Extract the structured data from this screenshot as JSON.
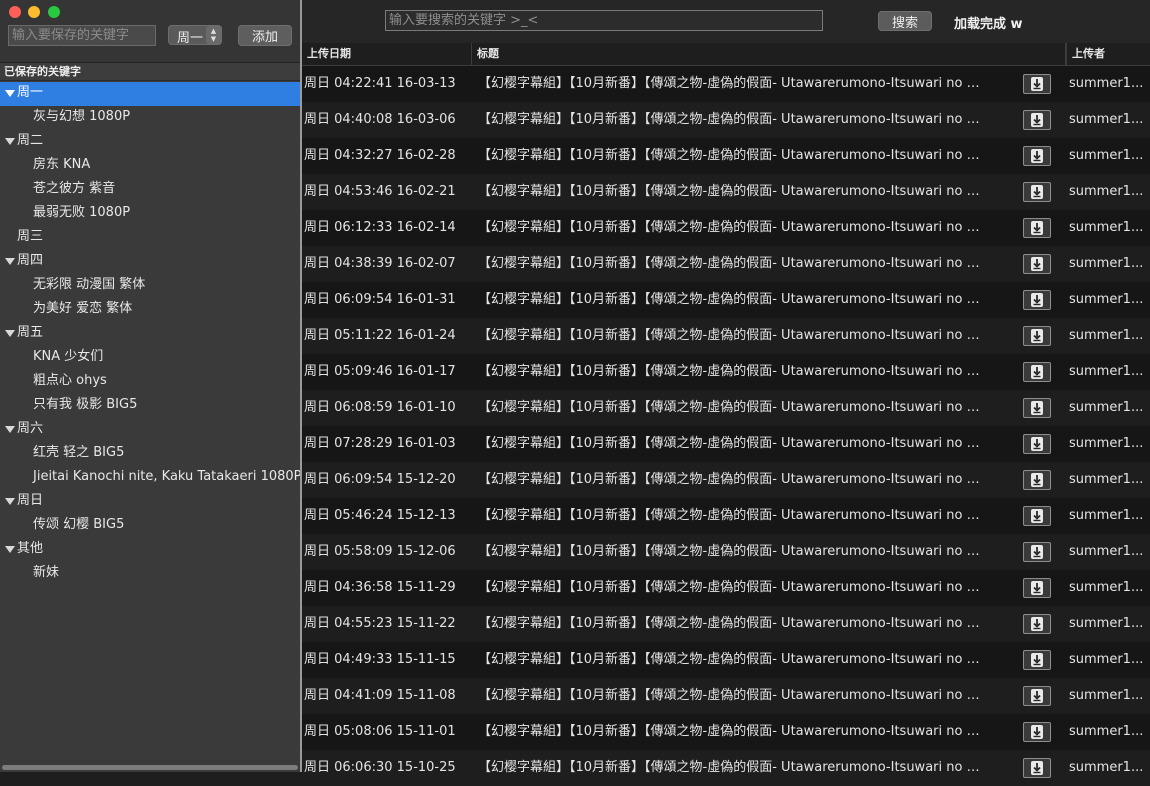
{
  "window": {
    "traffic_lights": {
      "close": "#fe5f57",
      "minimize": "#febc2e",
      "maximize": "#28c840"
    }
  },
  "left_panel": {
    "keyword_placeholder": "输入要保存的关键字",
    "day_select_value": "周一",
    "add_label": "添加",
    "saved_header": "已保存的关键字",
    "tree": [
      {
        "type": "group",
        "label": "周一",
        "expanded": true,
        "selected": true
      },
      {
        "type": "child",
        "label": "灰与幻想 1080P"
      },
      {
        "type": "group",
        "label": "周二",
        "expanded": true
      },
      {
        "type": "child",
        "label": "房东 KNA"
      },
      {
        "type": "child",
        "label": "苍之彼方 紫音"
      },
      {
        "type": "child",
        "label": "最弱无败 1080P"
      },
      {
        "type": "group",
        "label": "周三",
        "expanded": false
      },
      {
        "type": "group",
        "label": "周四",
        "expanded": true
      },
      {
        "type": "child",
        "label": "无彩限 动漫国 繁体"
      },
      {
        "type": "child",
        "label": "为美好 爱恋 繁体"
      },
      {
        "type": "group",
        "label": "周五",
        "expanded": true
      },
      {
        "type": "child",
        "label": "KNA 少女们"
      },
      {
        "type": "child",
        "label": "粗点心 ohys"
      },
      {
        "type": "child",
        "label": "只有我 极影 BIG5"
      },
      {
        "type": "group",
        "label": "周六",
        "expanded": true
      },
      {
        "type": "child",
        "label": "红壳 轻之 BIG5"
      },
      {
        "type": "child",
        "label": "Jieitai Kanochi nite, Kaku Tatakaeri 1080P"
      },
      {
        "type": "group",
        "label": "周日",
        "expanded": true
      },
      {
        "type": "child",
        "label": "传颂 幻樱 BIG5"
      },
      {
        "type": "group",
        "label": "其他",
        "expanded": true
      },
      {
        "type": "child",
        "label": "新妹"
      }
    ],
    "selection_color": "#2f7fe2"
  },
  "right_panel": {
    "search_placeholder": "输入要搜索的关键字 >_<",
    "search_label": "搜索",
    "status_text": "加载完成 w",
    "columns": {
      "date": "上传日期",
      "title": "标题",
      "uploader": "上传者"
    },
    "download_icon": "download-arrow-icon",
    "rows": [
      {
        "date": "周日 04:22:41 16-03-13",
        "title": "【幻樱字幕組】【10月新番】【傳頌之物-虛偽的假面- Utawarerumono-Itsuwari no K...",
        "uploader": "summer1..."
      },
      {
        "date": "周日 04:40:08 16-03-06",
        "title": "【幻樱字幕組】【10月新番】【傳頌之物-虛偽的假面- Utawarerumono-Itsuwari no K...",
        "uploader": "summer1..."
      },
      {
        "date": "周日 04:32:27 16-02-28",
        "title": "【幻樱字幕組】【10月新番】【傳頌之物-虛偽的假面- Utawarerumono-Itsuwari no K...",
        "uploader": "summer1..."
      },
      {
        "date": "周日 04:53:46 16-02-21",
        "title": "【幻樱字幕組】【10月新番】【傳頌之物-虛偽的假面- Utawarerumono-Itsuwari no K...",
        "uploader": "summer1..."
      },
      {
        "date": "周日 06:12:33 16-02-14",
        "title": "【幻樱字幕組】【10月新番】【傳頌之物-虛偽的假面- Utawarerumono-Itsuwari no K...",
        "uploader": "summer1..."
      },
      {
        "date": "周日 04:38:39 16-02-07",
        "title": "【幻樱字幕組】【10月新番】【傳頌之物-虛偽的假面- Utawarerumono-Itsuwari no K...",
        "uploader": "summer1..."
      },
      {
        "date": "周日 06:09:54 16-01-31",
        "title": "【幻樱字幕組】【10月新番】【傳頌之物-虛偽的假面- Utawarerumono-Itsuwari no K...",
        "uploader": "summer1..."
      },
      {
        "date": "周日 05:11:22 16-01-24",
        "title": "【幻樱字幕組】【10月新番】【傳頌之物-虛偽的假面- Utawarerumono-Itsuwari no K...",
        "uploader": "summer1..."
      },
      {
        "date": "周日 05:09:46 16-01-17",
        "title": "【幻樱字幕組】【10月新番】【傳頌之物-虛偽的假面- Utawarerumono-Itsuwari no K...",
        "uploader": "summer1..."
      },
      {
        "date": "周日 06:08:59 16-01-10",
        "title": "【幻樱字幕組】【10月新番】【傳頌之物-虛偽的假面- Utawarerumono-Itsuwari no K...",
        "uploader": "summer1..."
      },
      {
        "date": "周日 07:28:29 16-01-03",
        "title": "【幻樱字幕組】【10月新番】【傳頌之物-虛偽的假面- Utawarerumono-Itsuwari no K...",
        "uploader": "summer1..."
      },
      {
        "date": "周日 06:09:54 15-12-20",
        "title": "【幻樱字幕組】【10月新番】【傳頌之物-虛偽的假面- Utawarerumono-Itsuwari no K...",
        "uploader": "summer1..."
      },
      {
        "date": "周日 05:46:24 15-12-13",
        "title": "【幻樱字幕組】【10月新番】【傳頌之物-虛偽的假面- Utawarerumono-Itsuwari no K...",
        "uploader": "summer1..."
      },
      {
        "date": "周日 05:58:09 15-12-06",
        "title": "【幻樱字幕組】【10月新番】【傳頌之物-虛偽的假面- Utawarerumono-Itsuwari no K...",
        "uploader": "summer1..."
      },
      {
        "date": "周日 04:36:58 15-11-29",
        "title": "【幻樱字幕組】【10月新番】【傳頌之物-虛偽的假面- Utawarerumono-Itsuwari no K...",
        "uploader": "summer1..."
      },
      {
        "date": "周日 04:55:23 15-11-22",
        "title": "【幻樱字幕組】【10月新番】【傳頌之物-虛偽的假面- Utawarerumono-Itsuwari no K...",
        "uploader": "summer1..."
      },
      {
        "date": "周日 04:49:33 15-11-15",
        "title": "【幻樱字幕組】【10月新番】【傳頌之物-虛偽的假面- Utawarerumono-Itsuwari no K...",
        "uploader": "summer1..."
      },
      {
        "date": "周日 04:41:09 15-11-08",
        "title": "【幻樱字幕組】【10月新番】【傳頌之物-虛偽的假面- Utawarerumono-Itsuwari no K...",
        "uploader": "summer1..."
      },
      {
        "date": "周日 05:08:06 15-11-01",
        "title": "【幻樱字幕組】【10月新番】【傳頌之物-虛偽的假面- Utawarerumono-Itsuwari no K...",
        "uploader": "summer1..."
      },
      {
        "date": "周日 06:06:30 15-10-25",
        "title": "【幻樱字幕組】【10月新番】【傳頌之物-虛偽的假面- Utawarerumono-Itsuwari no K...",
        "uploader": "summer1..."
      }
    ]
  }
}
